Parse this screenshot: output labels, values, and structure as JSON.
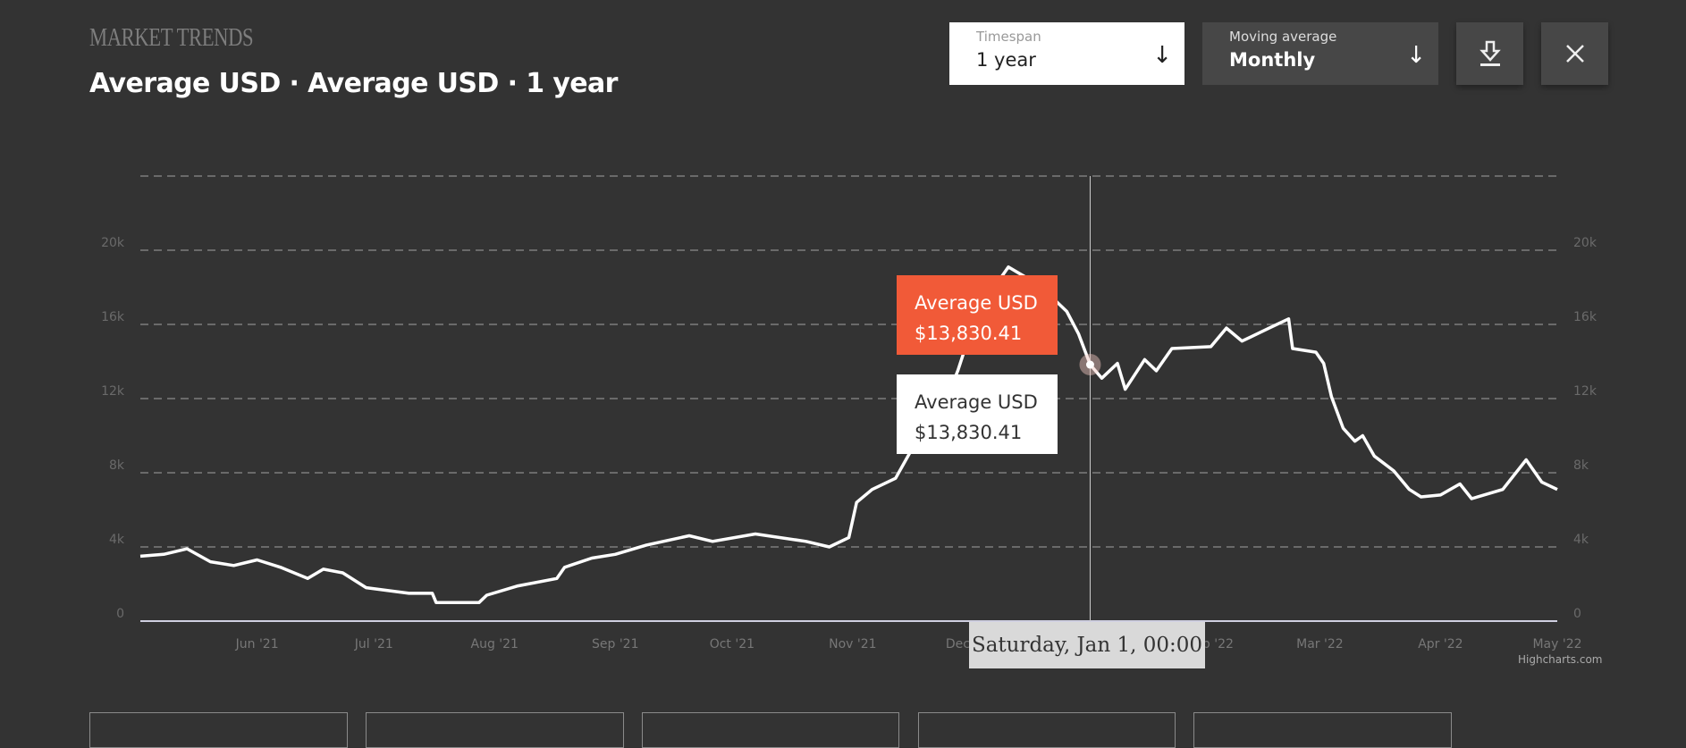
{
  "header": {
    "kicker": "MARKET TRENDS",
    "title": "Average USD · Average USD · 1 year"
  },
  "controls": {
    "timespan": {
      "label": "Timespan",
      "value": "1 year",
      "icon": "arrow-down-icon"
    },
    "moving_average": {
      "label": "Moving average",
      "value": "Monthly",
      "icon": "arrow-down-icon"
    },
    "download_icon": "download-icon",
    "close_icon": "close-icon"
  },
  "tooltip": {
    "primary": {
      "series": "Average USD",
      "value": "$13,830.41"
    },
    "secondary": {
      "series": "Average USD",
      "value": "$13,830.41"
    },
    "date": "Saturday, Jan 1, 00:00"
  },
  "credits": "Highcharts.com",
  "colors": {
    "background": "#333333",
    "line": "#ffffff",
    "tooltip_accent": "#f15a38",
    "grid": "#8a8a8a"
  },
  "chart_data": {
    "type": "line",
    "title": "",
    "xlabel": "",
    "ylabel": "",
    "x_range": [
      "2021-05-02",
      "2022-05-01"
    ],
    "ylim": [
      0,
      24000
    ],
    "grid": true,
    "y_axis_both_sides": true,
    "y_ticks": [
      0,
      4000,
      8000,
      12000,
      16000,
      20000,
      24000
    ],
    "y_tick_labels": [
      "0",
      "4k",
      "8k",
      "12k",
      "16k",
      "20k",
      ""
    ],
    "x_ticks": [
      "2021-06-01",
      "2021-07-01",
      "2021-08-01",
      "2021-09-01",
      "2021-10-01",
      "2021-11-01",
      "2021-12-01",
      "2022-01-01",
      "2022-02-01",
      "2022-03-01",
      "2022-04-01",
      "2022-05-01"
    ],
    "x_tick_labels": [
      "Jun '21",
      "Jul '21",
      "Aug '21",
      "Sep '21",
      "Oct '21",
      "Nov '21",
      "Dec '21",
      "Jan '22",
      "Feb '22",
      "Mar '22",
      "Apr '22",
      "May '22"
    ],
    "highlight": {
      "x": "2022-01-01",
      "y": 13830.41
    },
    "series": [
      {
        "name": "Average USD",
        "points": [
          [
            "2021-05-02",
            3500
          ],
          [
            "2021-05-08",
            3600
          ],
          [
            "2021-05-14",
            3900
          ],
          [
            "2021-05-20",
            3200
          ],
          [
            "2021-05-26",
            3000
          ],
          [
            "2021-06-01",
            3300
          ],
          [
            "2021-06-07",
            2900
          ],
          [
            "2021-06-14",
            2300
          ],
          [
            "2021-06-18",
            2800
          ],
          [
            "2021-06-23",
            2600
          ],
          [
            "2021-06-29",
            1800
          ],
          [
            "2021-07-10",
            1500
          ],
          [
            "2021-07-16",
            1500
          ],
          [
            "2021-07-17",
            1000
          ],
          [
            "2021-07-28",
            1000
          ],
          [
            "2021-07-30",
            1400
          ],
          [
            "2021-08-07",
            1900
          ],
          [
            "2021-08-17",
            2300
          ],
          [
            "2021-08-19",
            2900
          ],
          [
            "2021-08-26",
            3400
          ],
          [
            "2021-09-01",
            3600
          ],
          [
            "2021-09-09",
            4100
          ],
          [
            "2021-09-20",
            4600
          ],
          [
            "2021-09-26",
            4300
          ],
          [
            "2021-10-07",
            4700
          ],
          [
            "2021-10-20",
            4300
          ],
          [
            "2021-10-26",
            4000
          ],
          [
            "2021-10-31",
            4500
          ],
          [
            "2021-11-02",
            6400
          ],
          [
            "2021-11-06",
            7100
          ],
          [
            "2021-11-12",
            7700
          ],
          [
            "2021-11-16",
            9200
          ],
          [
            "2021-11-23",
            10900
          ],
          [
            "2021-11-28",
            13500
          ],
          [
            "2021-12-03",
            16700
          ],
          [
            "2021-12-11",
            19100
          ],
          [
            "2021-12-19",
            18100
          ],
          [
            "2021-12-26",
            16700
          ],
          [
            "2021-12-29",
            15500
          ],
          [
            "2022-01-01",
            13830.41
          ],
          [
            "2022-01-04",
            13100
          ],
          [
            "2022-01-08",
            13900
          ],
          [
            "2022-01-10",
            12500
          ],
          [
            "2022-01-15",
            14100
          ],
          [
            "2022-01-18",
            13500
          ],
          [
            "2022-01-22",
            14700
          ],
          [
            "2022-02-01",
            14800
          ],
          [
            "2022-02-05",
            15800
          ],
          [
            "2022-02-09",
            15100
          ],
          [
            "2022-02-16",
            15800
          ],
          [
            "2022-02-21",
            16300
          ],
          [
            "2022-02-22",
            14700
          ],
          [
            "2022-02-28",
            14500
          ],
          [
            "2022-03-02",
            13900
          ],
          [
            "2022-03-04",
            12100
          ],
          [
            "2022-03-07",
            10400
          ],
          [
            "2022-03-10",
            9700
          ],
          [
            "2022-03-12",
            10000
          ],
          [
            "2022-03-15",
            8900
          ],
          [
            "2022-03-20",
            8100
          ],
          [
            "2022-03-24",
            7100
          ],
          [
            "2022-03-27",
            6700
          ],
          [
            "2022-04-01",
            6800
          ],
          [
            "2022-04-06",
            7400
          ],
          [
            "2022-04-09",
            6600
          ],
          [
            "2022-04-17",
            7100
          ],
          [
            "2022-04-23",
            8700
          ],
          [
            "2022-04-27",
            7500
          ],
          [
            "2022-05-01",
            7100
          ]
        ]
      }
    ]
  }
}
